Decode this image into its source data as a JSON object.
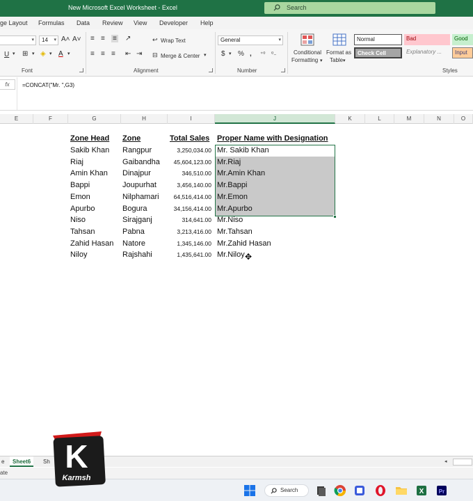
{
  "window": {
    "title": "New Microsoft Excel Worksheet  -  Excel"
  },
  "search": {
    "placeholder": "Search"
  },
  "ribbon_tabs": [
    "ge Layout",
    "Formulas",
    "Data",
    "Review",
    "View",
    "Developer",
    "Help"
  ],
  "ribbon": {
    "font_name": "",
    "font_size": "14",
    "wrap_text": "Wrap Text",
    "merge_center": "Merge & Center",
    "number_format": "General",
    "conditional_formatting_1": "Conditional",
    "conditional_formatting_2": "Formatting",
    "format_table_1": "Format as",
    "format_table_2": "Table",
    "groups": {
      "font": "Font",
      "alignment": "Alignment",
      "number": "Number",
      "styles": "Styles"
    },
    "styles": {
      "normal": "Normal",
      "bad": "Bad",
      "good": "Good",
      "check_cell": "Check Cell",
      "explanatory": "Explanatory ...",
      "input": "Input"
    },
    "colors": {
      "bad_bg": "#ffc7ce",
      "bad_fg": "#9c0006",
      "good_bg": "#c6efce",
      "good_fg": "#006100",
      "input_bg": "#ffcc99",
      "check_bg": "#a5a5a5"
    }
  },
  "formula_bar": {
    "fx": "fx",
    "formula": "=CONCAT(\"Mr. \",G3)"
  },
  "columns": [
    "E",
    "F",
    "G",
    "H",
    "I",
    "J",
    "K",
    "L",
    "M",
    "N",
    "O"
  ],
  "table": {
    "headers": {
      "zone_head": "Zone Head",
      "zone": "Zone",
      "total_sales": "Total Sales",
      "proper_name": "Proper Name with Designation"
    },
    "rows": [
      {
        "head": "Sakib Khan",
        "zone": "Rangpur",
        "sales": "3,250,034.00",
        "proper": "Mr. Sakib Khan"
      },
      {
        "head": "Riaj",
        "zone": "Gaibandha",
        "sales": "45,604,123.00",
        "proper": "Mr.Riaj"
      },
      {
        "head": "Amin Khan",
        "zone": "Dinajpur",
        "sales": "346,510.00",
        "proper": "Mr.Amin Khan"
      },
      {
        "head": "Bappi",
        "zone": "Joupurhat",
        "sales": "3,456,140.00",
        "proper": "Mr.Bappi"
      },
      {
        "head": "Emon",
        "zone": "Nilphamari",
        "sales": "64,516,414.00",
        "proper": "Mr.Emon"
      },
      {
        "head": "Apurbo",
        "zone": "Bogura",
        "sales": "34,156,414.00",
        "proper": "Mr.Apurbo"
      },
      {
        "head": "Niso",
        "zone": "Sirajganj",
        "sales": "314,641.00",
        "proper": "Mr.Niso"
      },
      {
        "head": "Tahsan",
        "zone": "Pabna",
        "sales": "3,213,416.00",
        "proper": "Mr.Tahsan"
      },
      {
        "head": "Zahid Hasan",
        "zone": "Natore",
        "sales": "1,345,146.00",
        "proper": "Mr.Zahid Hasan"
      },
      {
        "head": "Niloy",
        "zone": "Rajshahi",
        "sales": "1,435,641.00",
        "proper": "Mr.Niloy"
      }
    ]
  },
  "sheets": {
    "prev": "e",
    "active": "Sheet6",
    "next": "Sh"
  },
  "status": {
    "text": "ate"
  },
  "taskbar": {
    "search": "Search"
  },
  "logo": {
    "letter": "K",
    "text": "Karmsh"
  },
  "colors": {
    "excel_green": "#217346",
    "titlebar": "#1f7245"
  }
}
